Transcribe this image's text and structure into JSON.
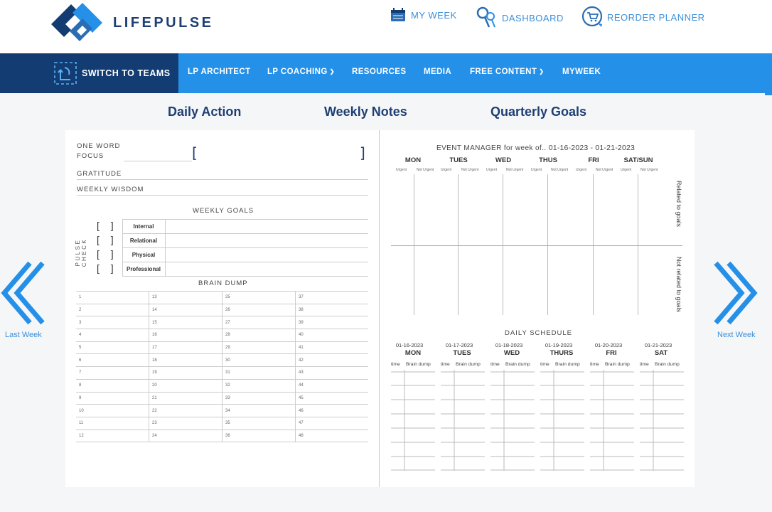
{
  "header": {
    "brand": "LIFEPULSE",
    "links": [
      {
        "label": "MY WEEK"
      },
      {
        "label": "DASHBOARD"
      },
      {
        "label": "REORDER PLANNER"
      }
    ]
  },
  "nav": {
    "teams": "SWITCH TO TEAMS",
    "items": [
      "LP ARCHITECT",
      "LP COACHING",
      "RESOURCES",
      "MEDIA",
      "FREE CONTENT",
      "MYWEEK"
    ]
  },
  "tabs": [
    "Daily Action",
    "Weekly Notes",
    "Quarterly Goals"
  ],
  "left": {
    "one_word": "ONE WORD",
    "focus": "FOCUS",
    "gratitude": "GRATITUDE",
    "wisdom": "WEEKLY WISDOM",
    "weekly_goals": "WEEKLY GOALS",
    "pulse_check": "PULSE CHECK",
    "goals": [
      "Internal",
      "Relational",
      "Physical",
      "Professional"
    ],
    "checkbox": "[ ]",
    "brain_dump": "BRAIN DUMP",
    "brain_rows": [
      [
        "1",
        "13",
        "25",
        "37"
      ],
      [
        "2",
        "14",
        "26",
        "38"
      ],
      [
        "3",
        "15",
        "27",
        "39"
      ],
      [
        "4",
        "16",
        "28",
        "40"
      ],
      [
        "5",
        "17",
        "29",
        "41"
      ],
      [
        "6",
        "18",
        "30",
        "42"
      ],
      [
        "7",
        "19",
        "31",
        "43"
      ],
      [
        "8",
        "20",
        "32",
        "44"
      ],
      [
        "9",
        "21",
        "33",
        "45"
      ],
      [
        "10",
        "22",
        "34",
        "46"
      ],
      [
        "11",
        "23",
        "35",
        "47"
      ],
      [
        "12",
        "24",
        "36",
        "48"
      ]
    ],
    "bracket_open": "[",
    "bracket_close": "]"
  },
  "event_manager": {
    "title": "EVENT MANAGER for week of..",
    "dates": "01-16-2023 - 01-21-2023",
    "days": [
      "MON",
      "TUES",
      "WED",
      "THUS",
      "FRI",
      "SAT/SUN"
    ],
    "urgent": "Urgent",
    "not_urgent": "Not Urgent",
    "related": "Related to goals",
    "not_related": "Not related to goals"
  },
  "daily_schedule": {
    "title": "DAILY SCHEDULE",
    "days": [
      {
        "date": "01-16-2023",
        "day": "MON"
      },
      {
        "date": "01-17-2023",
        "day": "TUES"
      },
      {
        "date": "01-18-2023",
        "day": "WED"
      },
      {
        "date": "01-19-2023",
        "day": "THURS"
      },
      {
        "date": "01-20-2023",
        "day": "FRI"
      },
      {
        "date": "01-21-2023",
        "day": "SAT"
      }
    ],
    "time": "time",
    "brain": "Brain dump"
  },
  "arrows": {
    "prev": "Last Week",
    "next": "Next Week"
  },
  "colors": {
    "navy": "#133c72",
    "blue": "#2590e8",
    "link": "#3b8fd9"
  }
}
